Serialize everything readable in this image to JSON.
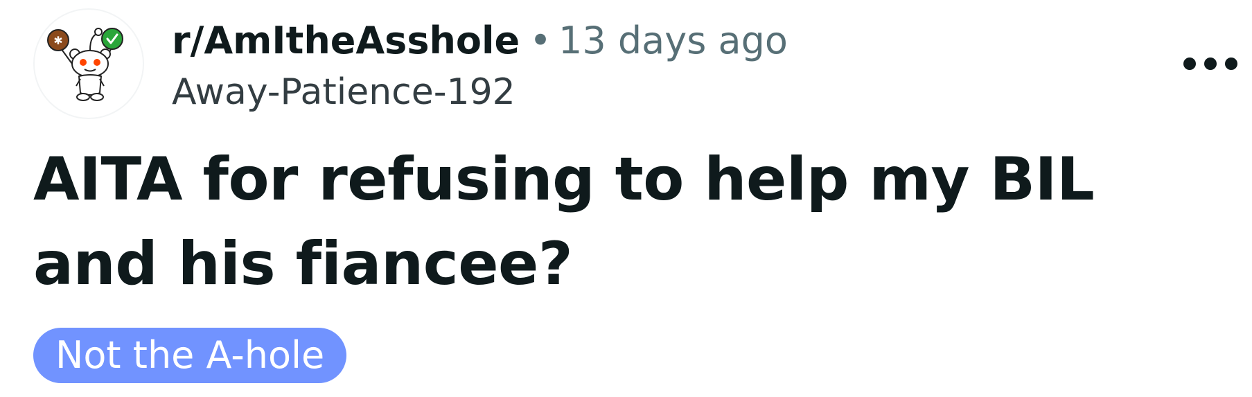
{
  "post": {
    "subreddit": "r/AmItheAsshole",
    "separator": "•",
    "timestamp": "13 days ago",
    "author": "Away-Patience-192",
    "title": "AITA for refusing to help my BIL and his fiancee?",
    "flair": "Not the A-hole",
    "overflow_icon": "more-horizontal-icon",
    "avatar_icon": "snoo-avatar-icon"
  },
  "colors": {
    "flair_background": "#7193ff",
    "flair_text": "#ffffff",
    "meta_gray": "#576f76",
    "title": "#0f1a1c"
  }
}
